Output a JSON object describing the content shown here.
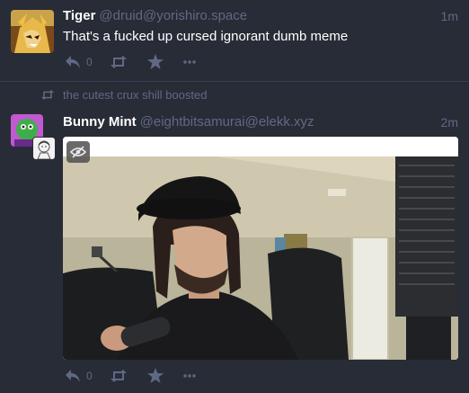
{
  "colors": {
    "background": "#282c37",
    "muted": "#606984",
    "text": "#ffffff",
    "divider": "#393f4f"
  },
  "status1": {
    "display_name": "Tiger",
    "account": "@druid@yorishiro.space",
    "time": "1m",
    "content": "That's a fucked up cursed ignorant dumb meme",
    "reply_count": "0",
    "icons": [
      "reply-icon",
      "boost-icon",
      "favourite-icon",
      "more-icon"
    ]
  },
  "boost_notice": {
    "text": "the cutest crux shill boosted"
  },
  "status2": {
    "display_name": "Bunny Mint",
    "account": "@eightbitsamurai@elekk.xyz",
    "time": "2m",
    "reply_count": "0",
    "media": {
      "type": "image",
      "description_visible": false,
      "hide_button_icon": "eye-slash-icon"
    },
    "icons": [
      "reply-icon",
      "boost-icon",
      "favourite-icon",
      "more-icon"
    ]
  }
}
